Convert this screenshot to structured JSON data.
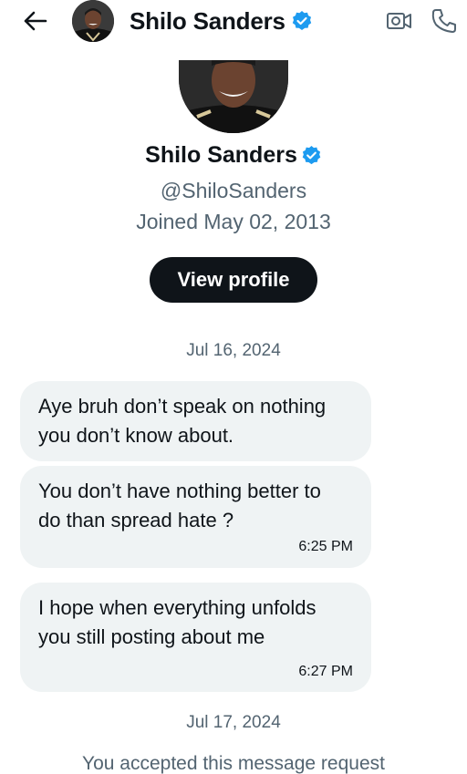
{
  "header": {
    "name": "Shilo Sanders",
    "icons": {
      "back": "arrow-left-icon",
      "verified": "verified-badge-icon",
      "video": "video-call-icon",
      "phone": "phone-icon"
    },
    "colors": {
      "verified": "#1d9bf0",
      "icon": "#536471"
    }
  },
  "profile": {
    "name": "Shilo Sanders",
    "handle": "@ShiloSanders",
    "joined": "Joined May 02, 2013",
    "view_profile_label": "View profile"
  },
  "conversation": {
    "date_1": "Jul 16, 2024",
    "messages": [
      {
        "text": "Aye bruh don’t speak on nothing you don’t know about.",
        "time": ""
      },
      {
        "text": "You don’t have nothing better to do than spread hate ?",
        "time": "6:25 PM"
      },
      {
        "text": "I hope when everything unfolds you still posting about me",
        "time": "6:27 PM"
      }
    ],
    "date_2": "Jul 17, 2024",
    "accepted_notice": "You accepted this message request"
  }
}
